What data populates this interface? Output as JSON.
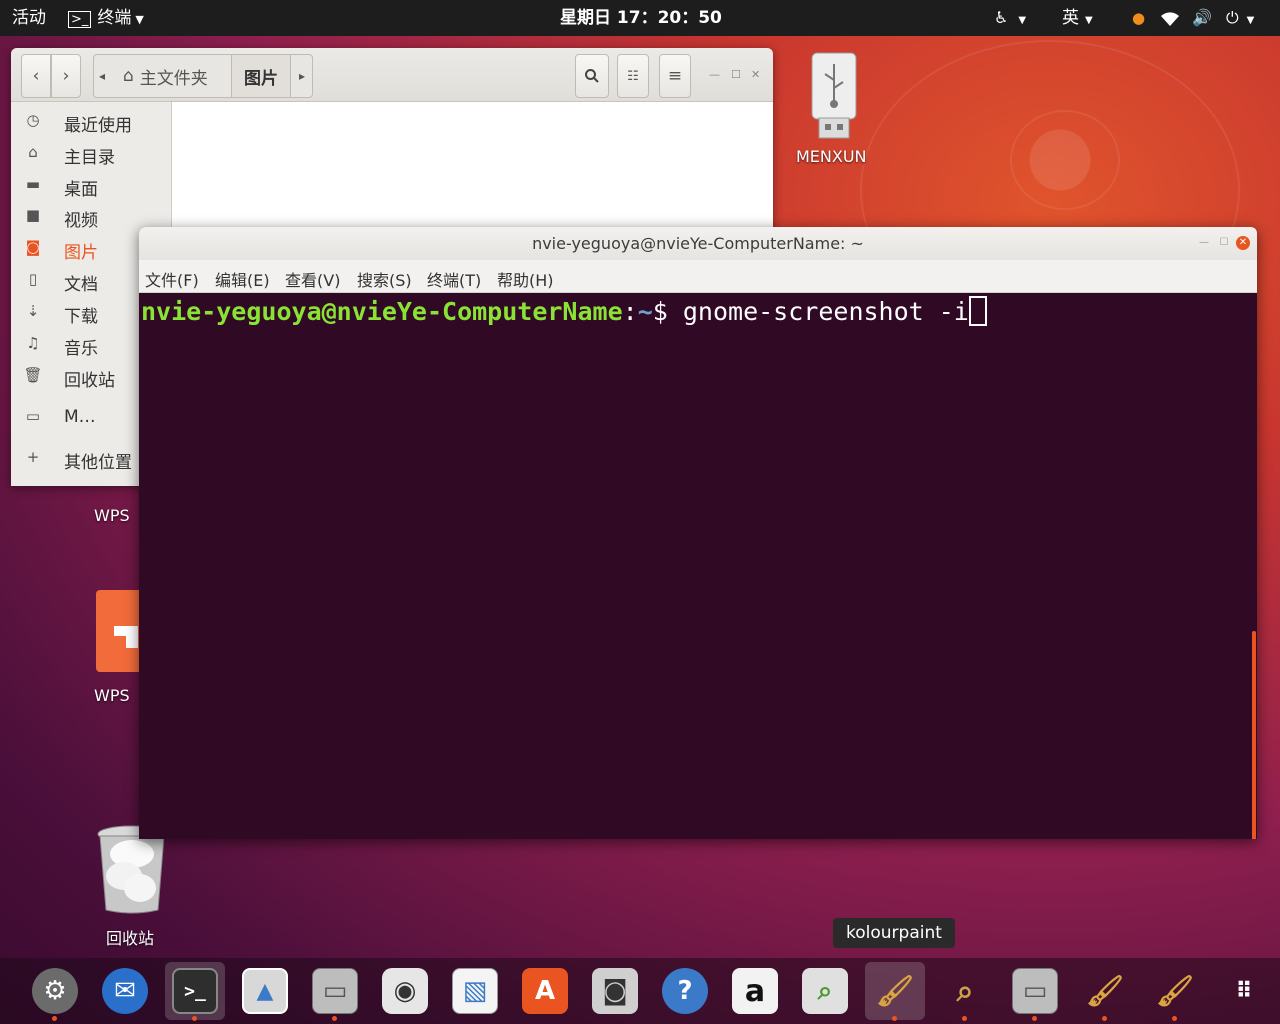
{
  "topbar": {
    "activities": "活动",
    "app_menu": "终端",
    "clock": "星期日 17：20：50",
    "input_method": "英"
  },
  "file_manager": {
    "path": [
      "主文件夹",
      "图片"
    ],
    "sidebar": [
      {
        "label": "最近使用",
        "icon": "clock-icon"
      },
      {
        "label": "主目录",
        "icon": "home-icon"
      },
      {
        "label": "桌面",
        "icon": "folder-icon"
      },
      {
        "label": "视频",
        "icon": "video-icon"
      },
      {
        "label": "图片",
        "icon": "camera-icon",
        "active": true
      },
      {
        "label": "文档",
        "icon": "document-icon"
      },
      {
        "label": "下载",
        "icon": "download-icon"
      },
      {
        "label": "音乐",
        "icon": "music-icon"
      },
      {
        "label": "回收站",
        "icon": "trash-icon"
      },
      {
        "label": "M…",
        "icon": "drive-icon"
      },
      {
        "label": "其他位置",
        "icon": "plus-icon"
      }
    ]
  },
  "desktop": {
    "usb_label": "MENXUN",
    "wps_label_1": "WPS",
    "wps_label_2": "WPS",
    "trash_label": "回收站"
  },
  "terminal": {
    "title": "nvie-yeguoya@nvieYe-ComputerName: ~",
    "menu": [
      "文件(F)",
      "编辑(E)",
      "查看(V)",
      "搜索(S)",
      "终端(T)",
      "帮助(H)"
    ],
    "prompt_user": "nvie-yeguoya@nvieYe-ComputerName",
    "prompt_sep": ":",
    "prompt_path": "~",
    "prompt_sign": "$ ",
    "command": "gnome-screenshot -i"
  },
  "tooltip": "kolourpaint",
  "dock": {
    "apps": [
      "settings",
      "thunderbird",
      "terminal",
      "image-viewer",
      "files",
      "rhythmbox",
      "libreoffice-draw",
      "software-center",
      "screenshot",
      "help",
      "amazon",
      "system-monitor",
      "kolourpaint",
      "magnifier",
      "files-2",
      "kolourpaint-2",
      "kolourpaint-3",
      "show-apps"
    ]
  },
  "colors": {
    "accent": "#e95420",
    "terminal_bg": "#300a24",
    "prompt_user": "#8ae234",
    "prompt_path": "#729fcf"
  }
}
